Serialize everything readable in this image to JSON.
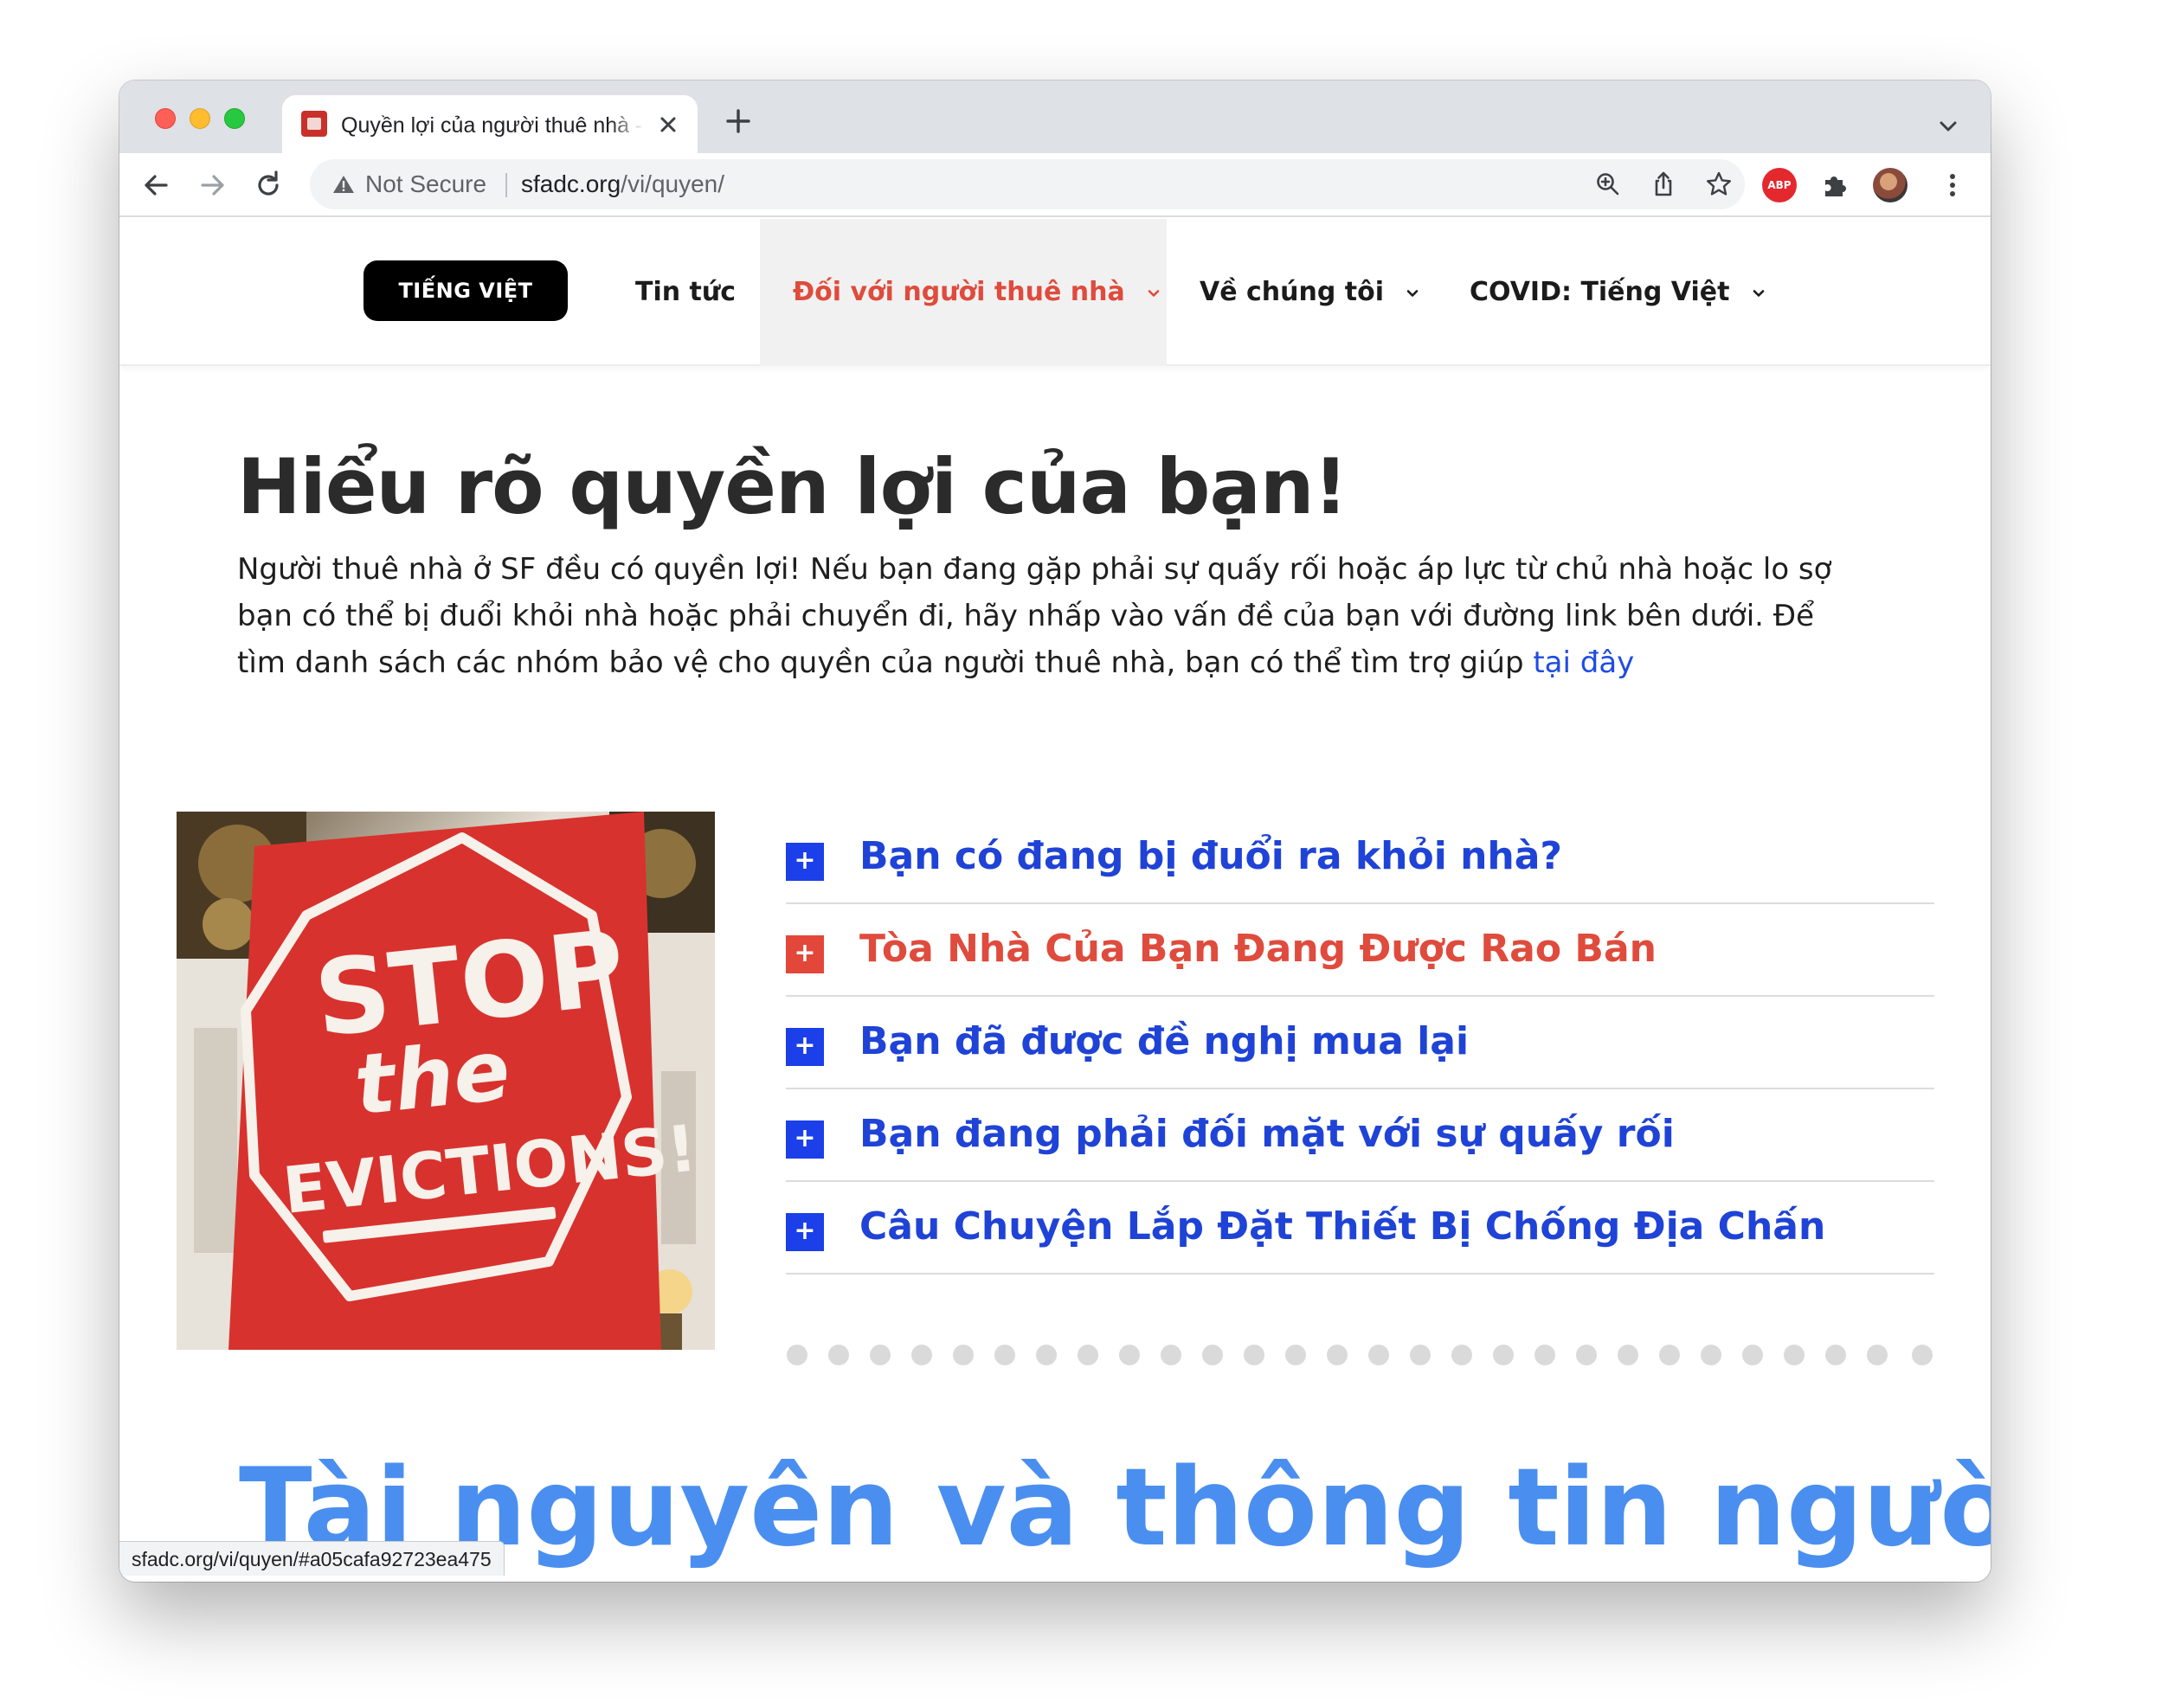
{
  "browser": {
    "tab_title": "Quyền lợi của người thuê nhà - SFADC",
    "security_label": "Not Secure",
    "url_host": "sfadc.org",
    "url_path": "/vi/quyen/",
    "status_url": "sfadc.org/vi/quyen/#a05cafa92723ea475",
    "extension_abp_label": "ABP"
  },
  "site_nav": {
    "language_button": "TIẾNG VIỆT",
    "items": [
      {
        "label": "Tin tức",
        "has_dropdown": false,
        "active": false
      },
      {
        "label": "Đối với người thuê nhà",
        "has_dropdown": true,
        "active": true
      },
      {
        "label": "Về chúng tôi",
        "has_dropdown": true,
        "active": false
      },
      {
        "label": "COVID: Tiếng Việt",
        "has_dropdown": true,
        "active": false
      }
    ]
  },
  "hero": {
    "title": "Hiểu rõ quyền lợi của bạn!",
    "intro": "Người thuê nhà ở SF đều có quyền lợi! Nếu bạn đang gặp phải sự quấy rối hoặc áp lực từ chủ nhà hoặc lo sợ bạn có thể bị đuổi khỏi nhà hoặc phải chuyển đi, hãy nhấp vào vấn đề của bạn  với đường link bên dưới. Để tìm danh sách các nhóm bảo vệ cho quyền của người thuê nhà, bạn có thể tìm trợ giúp ",
    "intro_link": "tại đây"
  },
  "photo": {
    "sign_lines": [
      "STOP",
      "the",
      "EVICTIONS!"
    ]
  },
  "accordion": {
    "items": [
      {
        "label": "Bạn có đang bị đuổi ra khỏi nhà?",
        "icon": "+",
        "highlighted": false
      },
      {
        "label": "Tòa Nhà Của Bạn Đang Được Rao Bán",
        "icon": "+",
        "highlighted": true
      },
      {
        "label": "Bạn đã được đề nghị mua lại",
        "icon": "+",
        "highlighted": false
      },
      {
        "label": "Bạn đang phải đối mặt với sự quấy rối",
        "icon": "+",
        "highlighted": false
      },
      {
        "label": "Câu Chuyện Lắp Đặt Thiết Bị Chống Địa Chấn",
        "icon": "+",
        "highlighted": false
      }
    ]
  },
  "section_heading": "Tài nguyên và thông tin người",
  "colors": {
    "accent_blue": "#1f43d6",
    "accent_red": "#df4b3c",
    "heading_blue": "#4a8ff0"
  }
}
